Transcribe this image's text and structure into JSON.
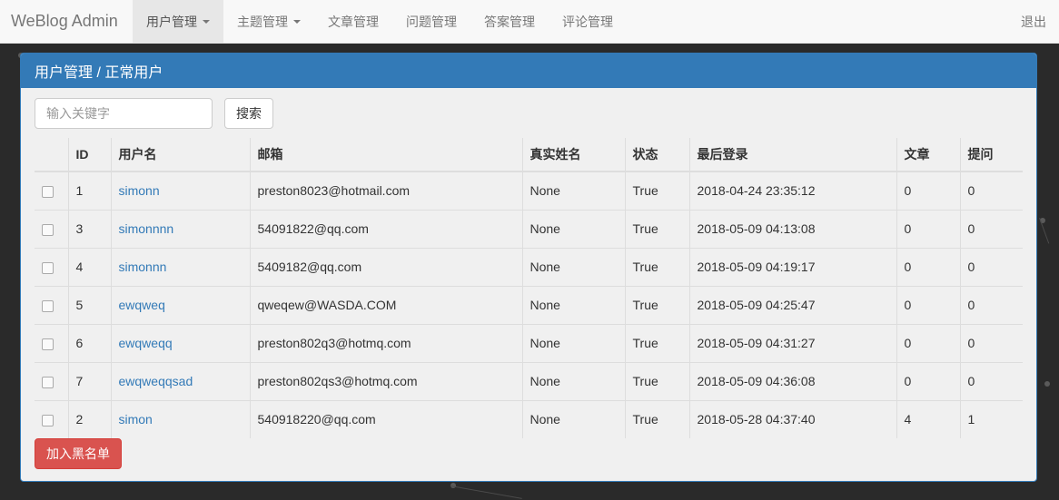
{
  "navbar": {
    "brand": "WeBlog Admin",
    "items": [
      {
        "label": "用户管理",
        "dropdown": true,
        "active": true
      },
      {
        "label": "主题管理",
        "dropdown": true,
        "active": false
      },
      {
        "label": "文章管理",
        "dropdown": false,
        "active": false
      },
      {
        "label": "问题管理",
        "dropdown": false,
        "active": false
      },
      {
        "label": "答案管理",
        "dropdown": false,
        "active": false
      },
      {
        "label": "评论管理",
        "dropdown": false,
        "active": false
      }
    ],
    "logout": "退出"
  },
  "panel": {
    "title": "用户管理 / 正常用户"
  },
  "search": {
    "placeholder": "输入关键字",
    "button": "搜索"
  },
  "table": {
    "columns": [
      "",
      "ID",
      "用户名",
      "邮箱",
      "真实姓名",
      "状态",
      "最后登录",
      "文章",
      "提问"
    ],
    "rows": [
      {
        "id": "1",
        "username": "simonn",
        "email": "preston8023@hotmail.com",
        "realname": "None",
        "status": "True",
        "last_login": "2018-04-24 23:35:12",
        "articles": "0",
        "questions": "0"
      },
      {
        "id": "3",
        "username": "simonnnn",
        "email": "54091822@qq.com",
        "realname": "None",
        "status": "True",
        "last_login": "2018-05-09 04:13:08",
        "articles": "0",
        "questions": "0"
      },
      {
        "id": "4",
        "username": "simonnn",
        "email": "5409182@qq.com",
        "realname": "None",
        "status": "True",
        "last_login": "2018-05-09 04:19:17",
        "articles": "0",
        "questions": "0"
      },
      {
        "id": "5",
        "username": "ewqweq",
        "email": "qweqew@WASDA.COM",
        "realname": "None",
        "status": "True",
        "last_login": "2018-05-09 04:25:47",
        "articles": "0",
        "questions": "0"
      },
      {
        "id": "6",
        "username": "ewqweqq",
        "email": "preston802q3@hotmq.com",
        "realname": "None",
        "status": "True",
        "last_login": "2018-05-09 04:31:27",
        "articles": "0",
        "questions": "0"
      },
      {
        "id": "7",
        "username": "ewqweqqsad",
        "email": "preston802qs3@hotmq.com",
        "realname": "None",
        "status": "True",
        "last_login": "2018-05-09 04:36:08",
        "articles": "0",
        "questions": "0"
      },
      {
        "id": "2",
        "username": "simon",
        "email": "540918220@qq.com",
        "realname": "None",
        "status": "True",
        "last_login": "2018-05-28 04:37:40",
        "articles": "4",
        "questions": "1"
      }
    ]
  },
  "actions": {
    "blacklist": "加入黑名单"
  },
  "colors": {
    "primary": "#337ab7",
    "danger": "#d9534f",
    "background": "#2a2a2a"
  }
}
